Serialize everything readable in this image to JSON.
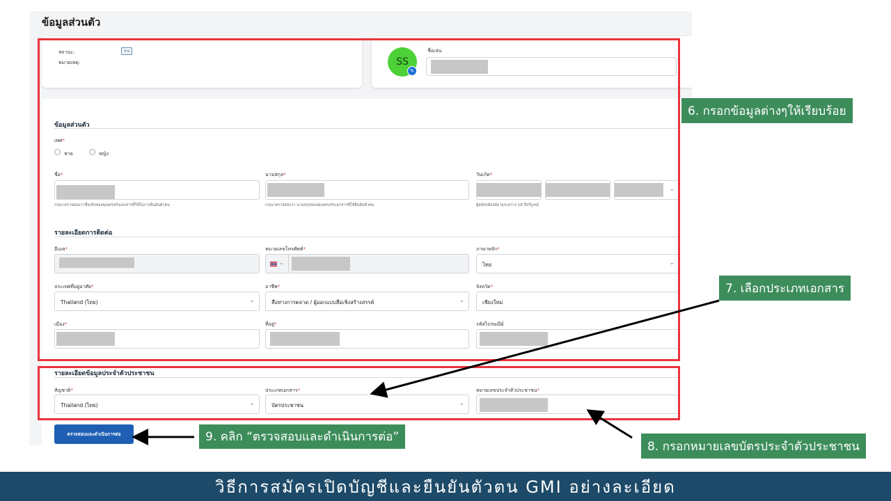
{
  "page": {
    "title": "ข้อมูลส่วนตัว"
  },
  "status_card": {
    "status_label": "สถานะ:",
    "status_badge": "ร่าง",
    "note_label": "หมายเหตุ:"
  },
  "profile_card": {
    "avatar_initials": "SS",
    "nickname_label": "ชื่อเล่น"
  },
  "personal": {
    "section_title": "ข้อมูลส่วนตัว",
    "gender_label": "เพศ",
    "gender_options": [
      "ชาย",
      "หญิง"
    ],
    "first_name_label": "ชื่อ",
    "first_name_hint": "กรุณาตรวจสอบว่าชื่อจริงของคุณตรงกับเอกสารที่ใช้ในการยืนยันตัวตน",
    "last_name_label": "นามสกุล",
    "last_name_hint": "กรุณาตรวจสอบว่า นามสกุลของคุณตรงกับเอกสารที่ใช้ยืนยันตัวตน",
    "dob_label": "วันเกิด",
    "dob_hint": "ผู้สมัครต้องมีอายุระหว่าง 18 ปีบริบูรณ์"
  },
  "contact": {
    "section_title": "รายละเอียดการติดต่อ",
    "email_label": "อีเมล",
    "phone_label": "หมายเลขโทรศัพท์",
    "language_label": "ภาษาหลัก",
    "language_value": "ไทย",
    "country_label": "ประเทศที่อยู่อาศัย",
    "country_value": "Thailand (ไทย)",
    "occupation_label": "อาชีพ",
    "occupation_value": "สื่อทางการตลาด / ผู้ออกแบบสื่อเชิงสร้างสรรค์",
    "province_label": "จังหวัด",
    "province_value": "เชียงใหม่",
    "city_label": "เมือง",
    "address_label": "ที่อยู่",
    "postcode_label": "รหัสไปรษณีย์"
  },
  "identity": {
    "section_title": "รายละเอียดข้อมูลประจำตัวประชาชน",
    "nationality_label": "สัญชาติ",
    "nationality_value": "Thailand (ไทย)",
    "doc_type_label": "ประเภทเอกสาร",
    "doc_type_value": "บัตรประชาชน",
    "id_number_label": "หมายเลขประจำตัวประชาชน"
  },
  "buttons": {
    "submit_label": "ตรวจสอบและดำเนินการต่อ"
  },
  "annotations": {
    "step6": "6. กรอกข้อมูลต่างๆให้เรียบร้อย",
    "step7": "7. เลือกประเภทเอกสาร",
    "step8": "8. กรอกหมายเลขบัตรประจำตัวประชาชน",
    "step9": "9. คลิก “ตรวจสอบและดำเนินการต่อ”"
  },
  "banner": {
    "text": "วิธีการสมัครเปิดบัญชีและยืนยันตัวตน GMI อย่างละเอียด"
  },
  "colors": {
    "highlight_red": "#e8343d",
    "callout_green": "#3d8d5b",
    "banner_navy": "#1d4a68",
    "primary_button": "#1e5fb4",
    "avatar_green": "#4cd137"
  },
  "icons": {
    "avatar_edit": "edit-icon",
    "select_arrow": "chevron-down-icon",
    "phone_country": "thailand-flag-icon"
  }
}
